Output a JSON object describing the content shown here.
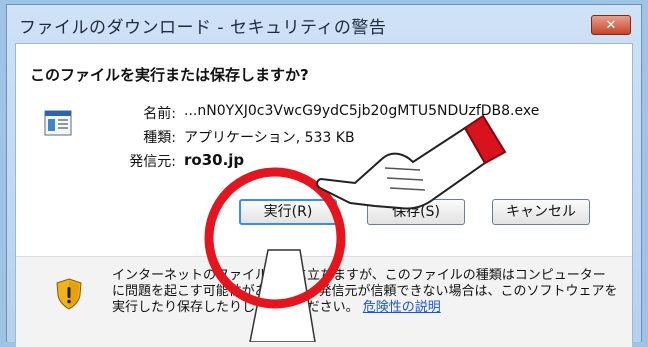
{
  "window": {
    "title": "ファイルのダウンロード - セキュリティの警告",
    "close_label": "✕"
  },
  "dialog": {
    "heading": "このファイルを実行または保存しますか?",
    "file_icon": "application-icon",
    "fields": [
      {
        "label": "名前:",
        "value": "...nN0YXJ0c3VwcG9ydC5jb20gMTU5NDUzfDB8.exe"
      },
      {
        "label": "種類:",
        "value": "アプリケーション, 533 KB"
      },
      {
        "label": "発信元:",
        "value": "ro30.jp"
      }
    ]
  },
  "buttons": {
    "run": "実行(R)",
    "save": "保存(S)",
    "cancel": "キャンセル"
  },
  "warning": {
    "icon": "shield-warning-icon",
    "text": "インターネットのファイルは役に立ちますが、このファイルの種類はコンピューターに問題を起こす可能性があります。発信元が信頼できない場合は、このソフトウェアを実行したり保存したりしないでください。",
    "link": "危険性の説明"
  },
  "annotation": {
    "highlight_icon": "pointing-hand-icon",
    "circle_color": "#e3161f",
    "callout_color": "#ffffff"
  }
}
